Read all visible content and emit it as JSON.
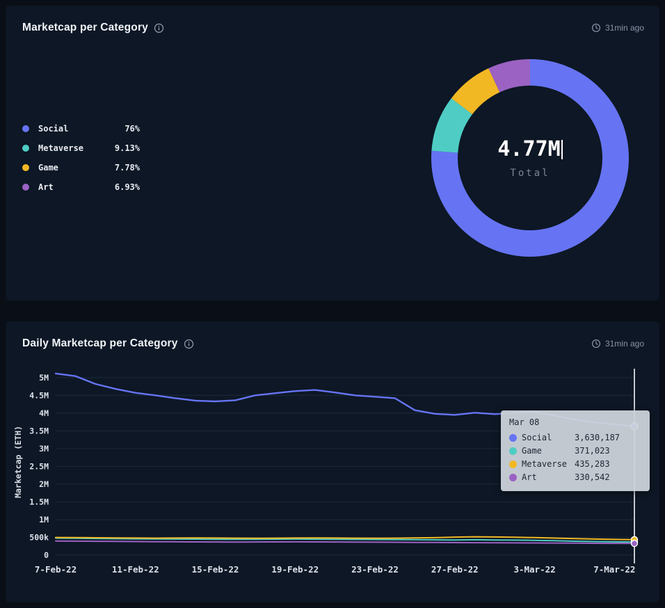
{
  "panels": [
    {
      "title": "Marketcap per Category",
      "updated": "31min ago"
    },
    {
      "title": "Daily Marketcap per Category",
      "updated": "31min ago"
    }
  ],
  "chart_data": [
    {
      "type": "pie",
      "title": "Marketcap per Category",
      "donut": true,
      "center_value": "4.77M",
      "center_label": "Total",
      "slices": [
        {
          "label": "Social",
          "pct": 76,
          "display_pct": "76%",
          "color": "#6674f3"
        },
        {
          "label": "Metaverse",
          "pct": 9.13,
          "display_pct": "9.13%",
          "color": "#4fcdc4"
        },
        {
          "label": "Game",
          "pct": 7.78,
          "display_pct": "7.78%",
          "color": "#f2b824"
        },
        {
          "label": "Art",
          "pct": 6.93,
          "display_pct": "6.93%",
          "color": "#9b62c3"
        }
      ]
    },
    {
      "type": "line",
      "title": "Daily Marketcap per Category",
      "ylabel": "Marketcap (ETH)",
      "ylim": [
        0,
        5250000
      ],
      "grid": true,
      "yticks": [
        {
          "v": 0,
          "label": "0"
        },
        {
          "v": 500000,
          "label": "500k"
        },
        {
          "v": 1000000,
          "label": "1M"
        },
        {
          "v": 1500000,
          "label": "1.5M"
        },
        {
          "v": 2000000,
          "label": "2M"
        },
        {
          "v": 2500000,
          "label": "2.5M"
        },
        {
          "v": 3000000,
          "label": "3M"
        },
        {
          "v": 3500000,
          "label": "3.5M"
        },
        {
          "v": 4000000,
          "label": "4M"
        },
        {
          "v": 4500000,
          "label": "4.5M"
        },
        {
          "v": 5000000,
          "label": "5M"
        }
      ],
      "x": [
        "7-Feb-22",
        "8-Feb-22",
        "9-Feb-22",
        "10-Feb-22",
        "11-Feb-22",
        "12-Feb-22",
        "13-Feb-22",
        "14-Feb-22",
        "15-Feb-22",
        "16-Feb-22",
        "17-Feb-22",
        "18-Feb-22",
        "19-Feb-22",
        "20-Feb-22",
        "21-Feb-22",
        "22-Feb-22",
        "23-Feb-22",
        "24-Feb-22",
        "25-Feb-22",
        "26-Feb-22",
        "27-Feb-22",
        "28-Feb-22",
        "1-Mar-22",
        "2-Mar-22",
        "3-Mar-22",
        "4-Mar-22",
        "5-Mar-22",
        "6-Mar-22",
        "7-Mar-22",
        "8-Mar-22"
      ],
      "xtick_labels": [
        "7-Feb-22",
        "11-Feb-22",
        "15-Feb-22",
        "19-Feb-22",
        "23-Feb-22",
        "27-Feb-22",
        "3-Mar-22",
        "7-Mar-22"
      ],
      "xtick_positions": [
        0,
        4,
        8,
        12,
        16,
        20,
        24,
        28
      ],
      "series": [
        {
          "name": "Social",
          "color": "#6674f3",
          "values": [
            5115000,
            5040000,
            4820000,
            4680000,
            4570000,
            4500000,
            4420000,
            4350000,
            4330000,
            4360000,
            4500000,
            4560000,
            4620000,
            4650000,
            4580000,
            4500000,
            4460000,
            4420000,
            4080000,
            3980000,
            3950000,
            4010000,
            3970000,
            4000000,
            4040000,
            3930000,
            3820000,
            3740000,
            3680000,
            3630187
          ]
        },
        {
          "name": "Game",
          "color": "#4fcdc4",
          "values": [
            480000,
            474000,
            468000,
            462000,
            458000,
            455000,
            452000,
            450000,
            447000,
            444000,
            446000,
            449000,
            452000,
            449000,
            446000,
            443000,
            441000,
            438000,
            434000,
            430000,
            426000,
            432000,
            428000,
            424000,
            418000,
            405000,
            392000,
            382000,
            375000,
            371023
          ]
        },
        {
          "name": "Metaverse",
          "color": "#f2b824",
          "values": [
            498000,
            494000,
            490000,
            486000,
            482000,
            478000,
            482000,
            486000,
            482000,
            478000,
            474000,
            478000,
            482000,
            486000,
            482000,
            478000,
            474000,
            478000,
            484000,
            492000,
            508000,
            518000,
            512000,
            504000,
            494000,
            480000,
            466000,
            452000,
            442000,
            435283
          ]
        },
        {
          "name": "Art",
          "color": "#9b62c3",
          "values": [
            398000,
            394000,
            390000,
            386000,
            382000,
            379000,
            376000,
            373000,
            370000,
            368000,
            370000,
            372000,
            374000,
            372000,
            370000,
            368000,
            365000,
            362000,
            359000,
            356000,
            353000,
            350000,
            348000,
            345000,
            342000,
            340000,
            337000,
            334000,
            332000,
            330542
          ]
        }
      ],
      "crosshair_index": 29,
      "tooltip": {
        "header": "Mar 08",
        "rows": [
          {
            "label": "Social",
            "value": "3,630,187",
            "color": "#6674f3"
          },
          {
            "label": "Game",
            "value": "371,023",
            "color": "#4fcdc4"
          },
          {
            "label": "Metaverse",
            "value": "435,283",
            "color": "#f2b824"
          },
          {
            "label": "Art",
            "value": "330,542",
            "color": "#9b62c3"
          }
        ]
      }
    }
  ]
}
